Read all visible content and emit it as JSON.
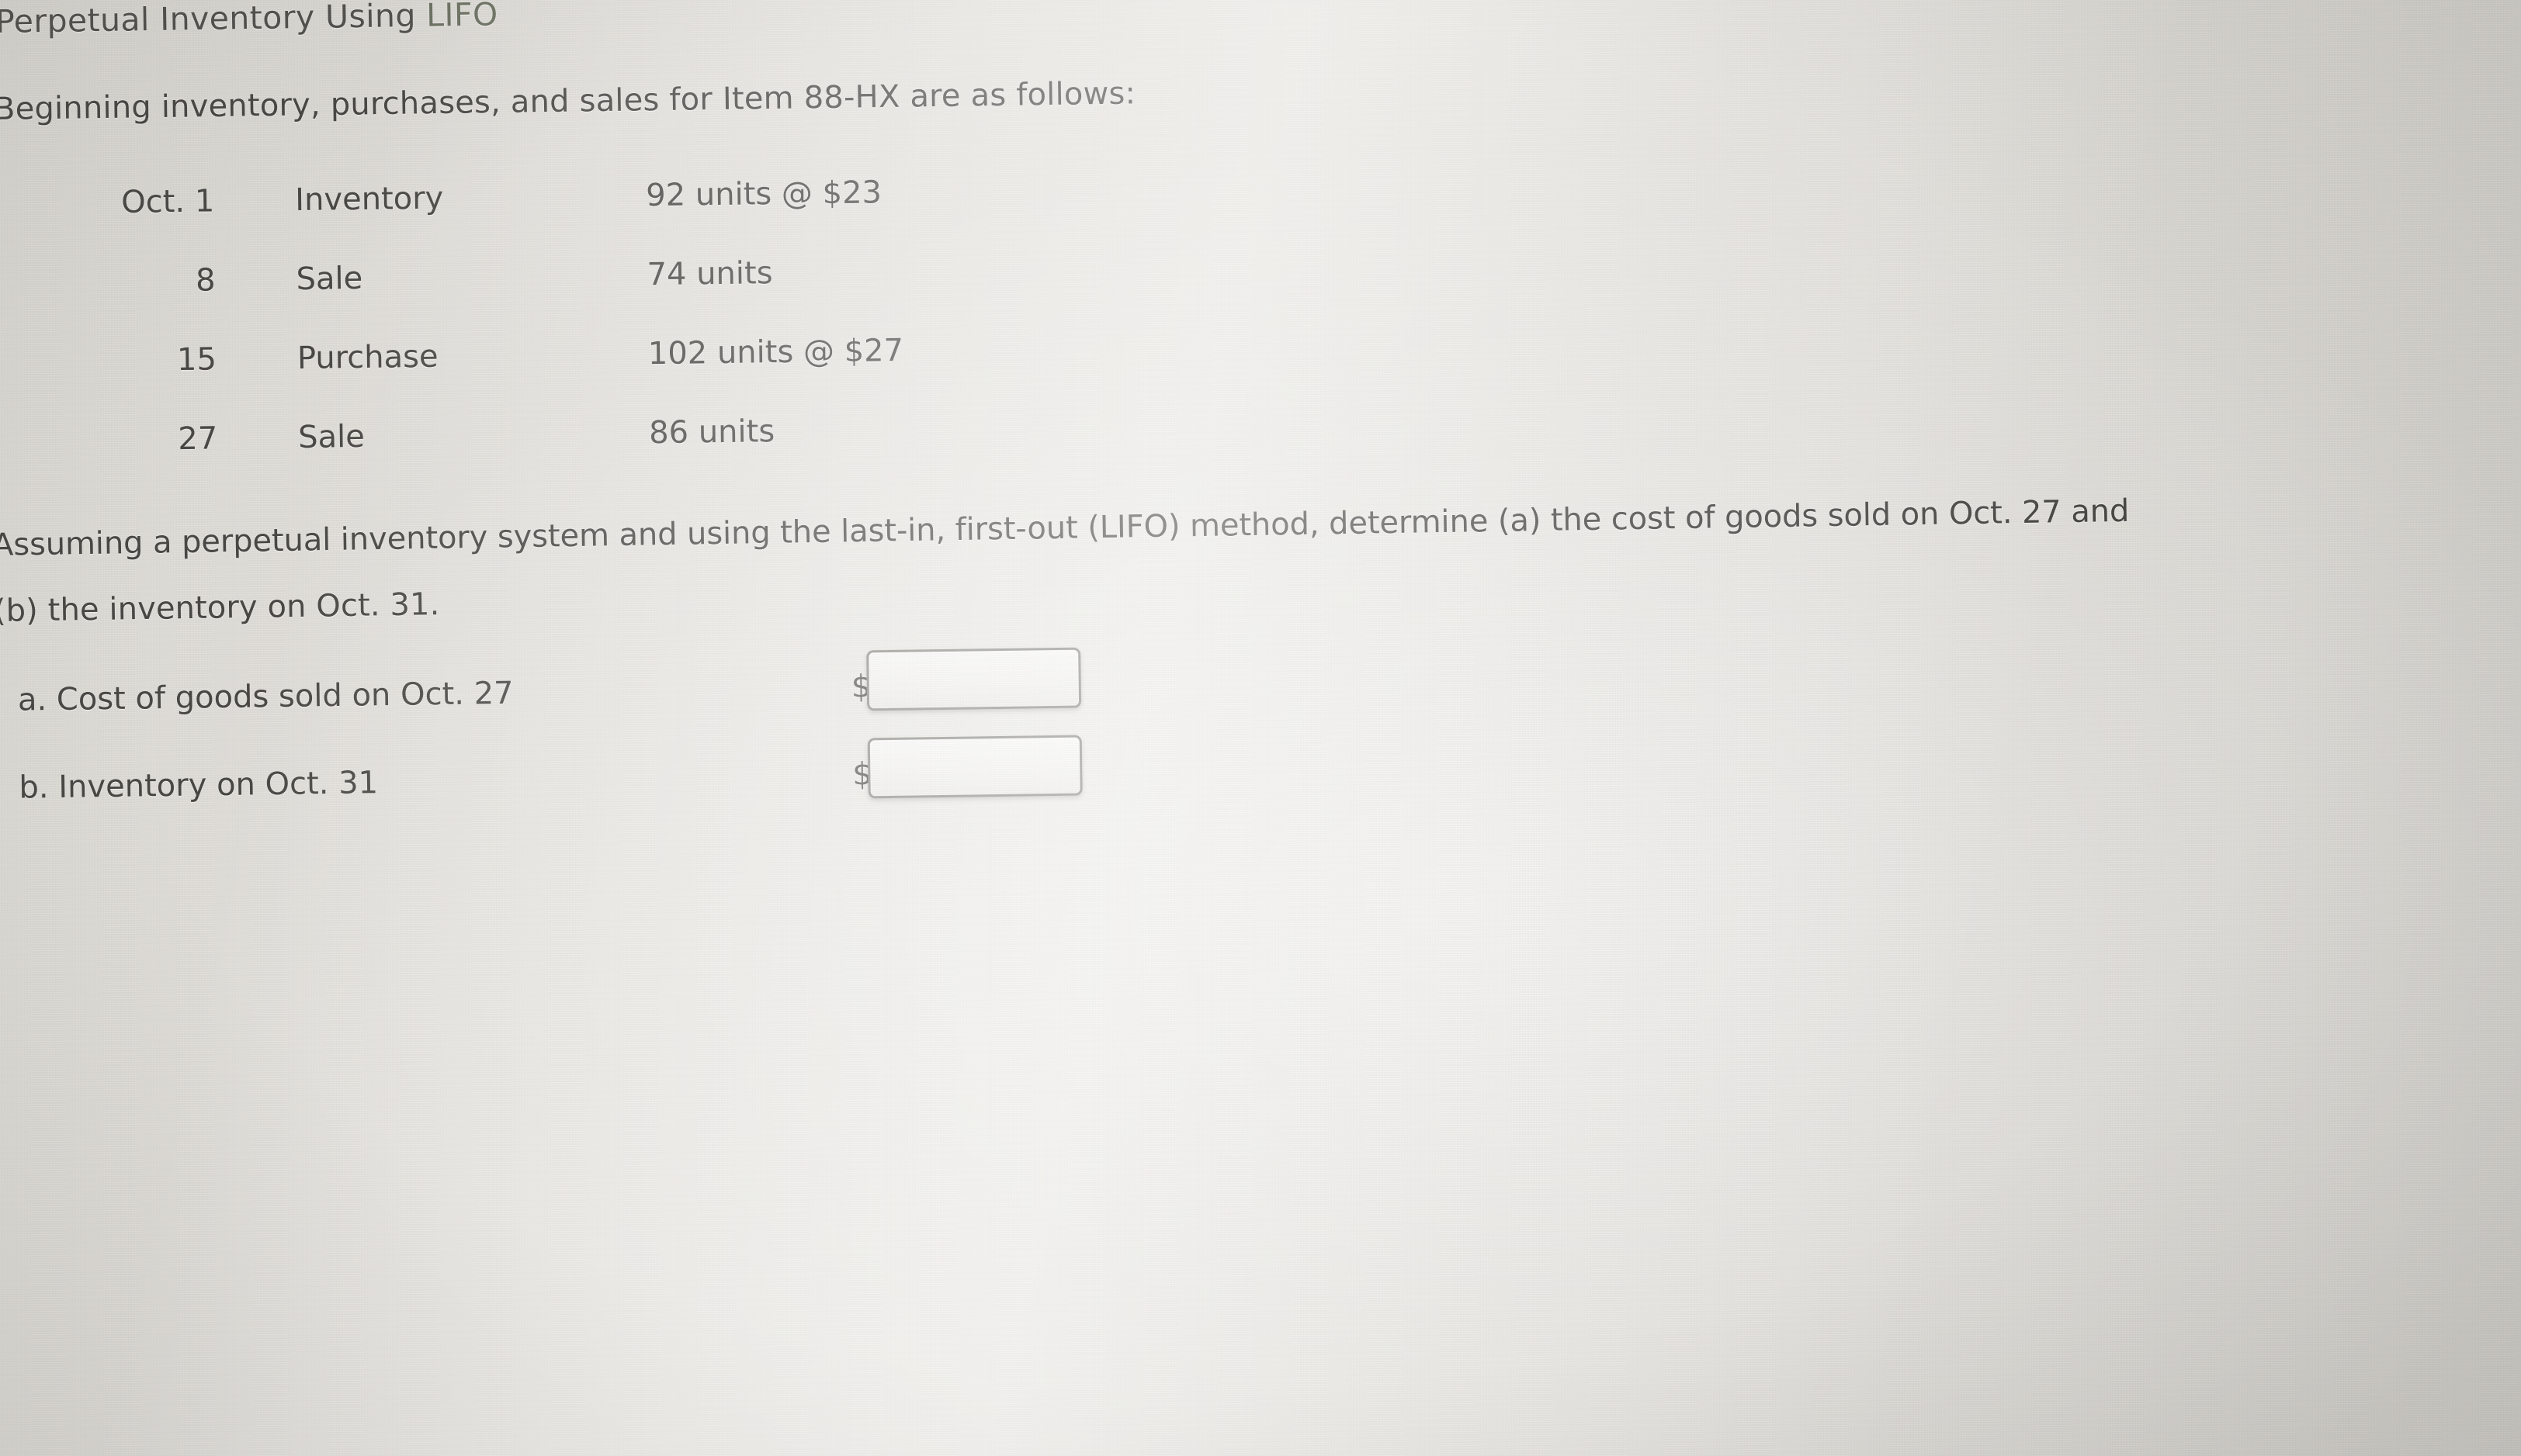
{
  "header": {
    "title_prefix": "Perpetual Inventory Using ",
    "title_method": "LIFO",
    "method_color": "#6d7363"
  },
  "intro": {
    "text": "Beginning inventory, purchases, and sales for Item 88-HX are as follows:",
    "item_code": "88-HX"
  },
  "transactions": {
    "rows": [
      {
        "date": "Oct. 1",
        "kind": "Inventory",
        "quantity": "92 units @ $23",
        "units": 92,
        "unit_cost": 23
      },
      {
        "date": "8",
        "kind": "Sale",
        "quantity": "74 units",
        "units": 74,
        "unit_cost": null
      },
      {
        "date": "15",
        "kind": "Purchase",
        "quantity": "102 units @ $27",
        "units": 102,
        "unit_cost": 27
      },
      {
        "date": "27",
        "kind": "Sale",
        "quantity": "86 units",
        "units": 86,
        "unit_cost": null
      }
    ]
  },
  "instructions": {
    "line1": "Assuming a perpetual inventory system and using the last-in, first-out (LIFO) method, determine (a) the cost of goods sold on Oct. 27 and",
    "line2": "(b) the inventory on Oct. 31."
  },
  "answers": {
    "rows": [
      {
        "label": "a. Cost of goods sold on Oct. 27",
        "currency_symbol": "$",
        "value": "",
        "placeholder": ""
      },
      {
        "label": "b. Inventory on Oct. 31",
        "currency_symbol": "$",
        "value": "",
        "placeholder": ""
      }
    ]
  }
}
